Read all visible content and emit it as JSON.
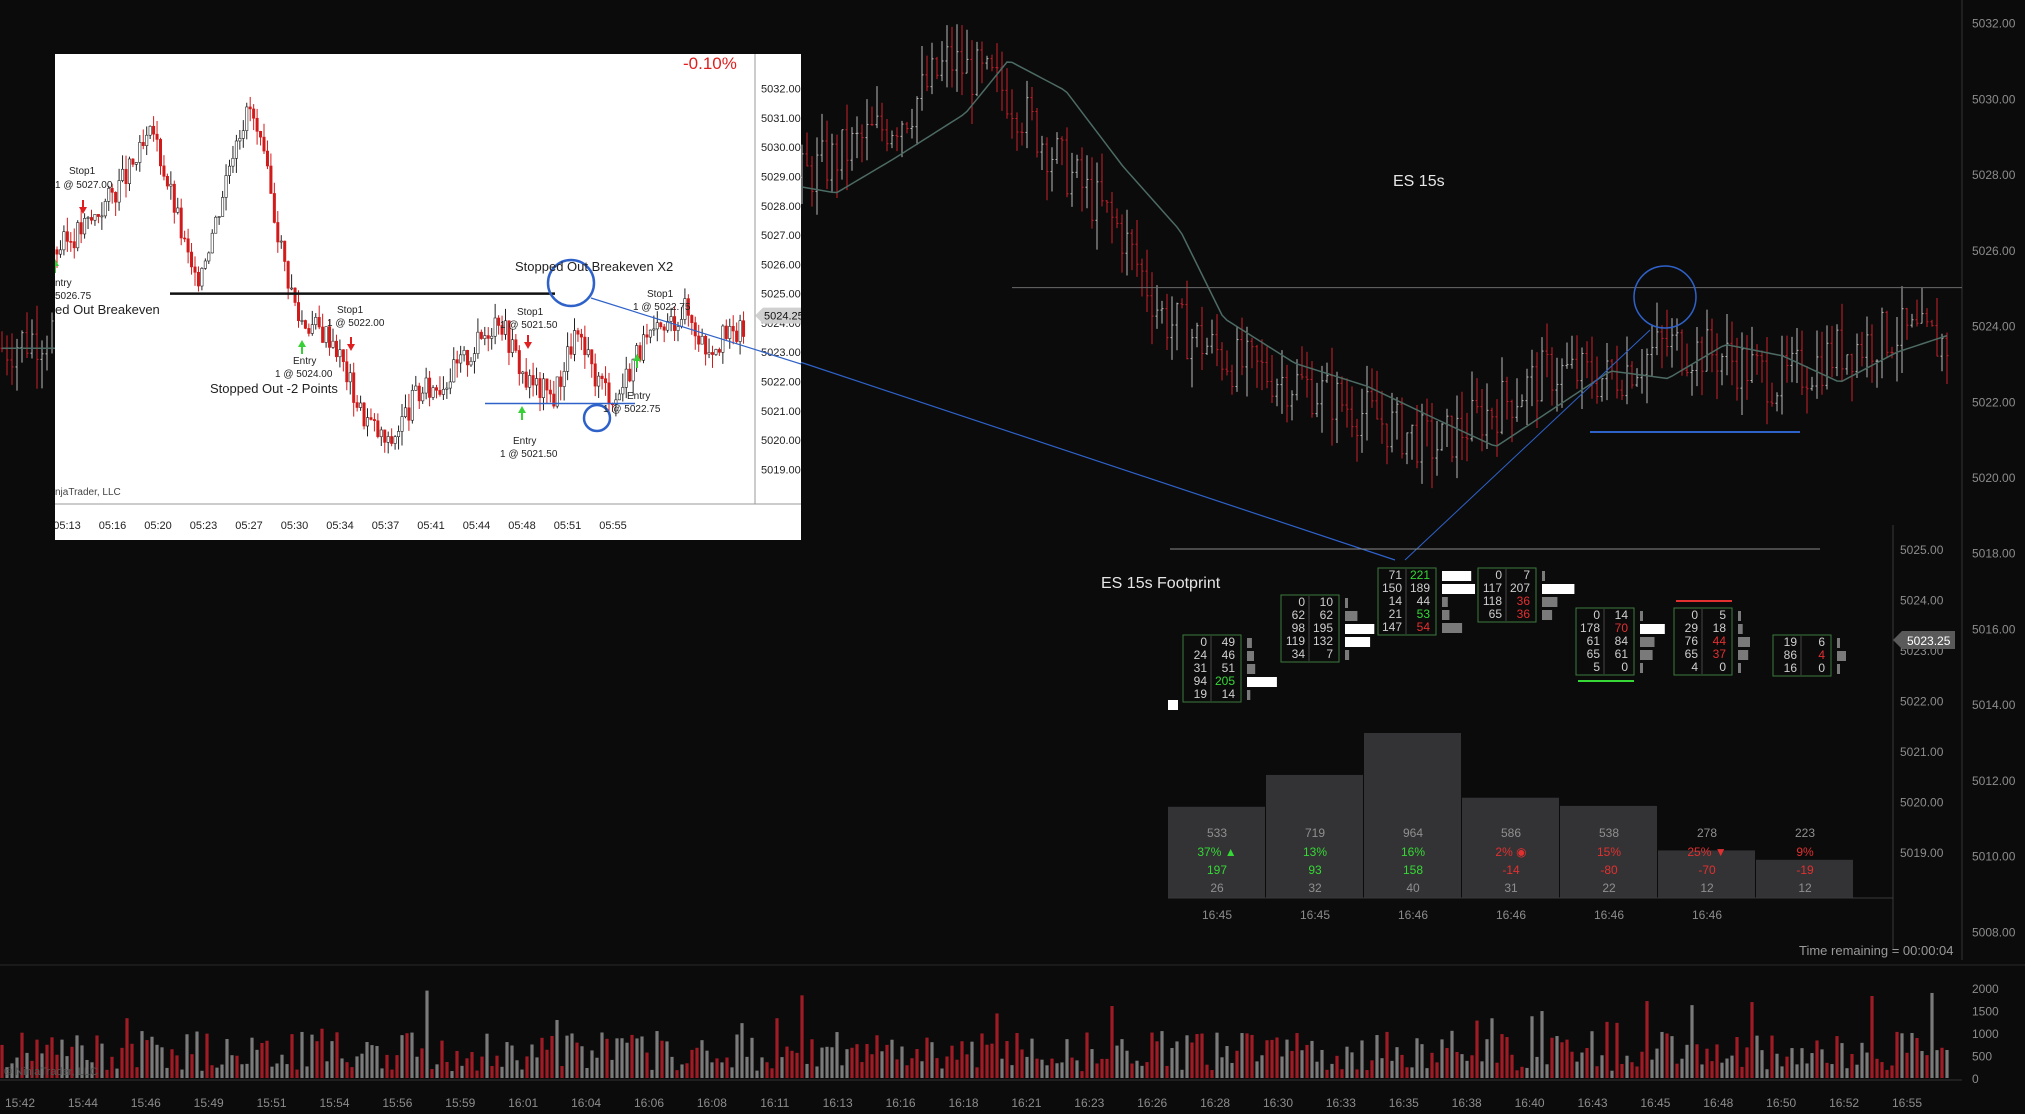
{
  "colors": {
    "background": "#0b0b0c",
    "up_candle": "#b9b9b9",
    "down_candle": "#c8202a",
    "ma_line": "#4d6b63",
    "grid": "#2a2a2a",
    "axis_text": "#8c8c8c",
    "annotation_blue": "#2f62c9",
    "inset_bg": "#ffffff",
    "inset_text": "#222222",
    "inset_down": "#d11a1a",
    "buy_green": "#35d835",
    "sell_red": "#e23030"
  },
  "main": {
    "chart_label": "ES 15s",
    "footprint_label": "ES 15s Footprint",
    "time_remaining": "Time remaining = 00:00:04",
    "price_axis": [
      "5032.00",
      "5030.00",
      "5028.00",
      "5026.00",
      "5024.00",
      "5022.00",
      "5020.00",
      "5018.00",
      "5016.00",
      "5014.00",
      "5012.00",
      "5010.00",
      "5008.00"
    ],
    "footprint_axis": [
      "5025.00",
      "5024.00",
      "5023.00",
      "5022.00",
      "5021.00",
      "5020.00",
      "5019.00"
    ],
    "current_price": "5023.25",
    "volume_axis": [
      "2000",
      "1500",
      "1000",
      "500",
      "0"
    ],
    "watermark": "© NinjaTrader, LLC",
    "time_axis": [
      "15:42",
      "15:44",
      "15:46",
      "15:49",
      "15:51",
      "15:54",
      "15:56",
      "15:59",
      "16:01",
      "16:04",
      "16:06",
      "16:08",
      "16:11",
      "16:13",
      "16:16",
      "16:18",
      "16:21",
      "16:23",
      "16:26",
      "16:28",
      "16:30",
      "16:33",
      "16:35",
      "16:38",
      "16:40",
      "16:43",
      "16:45",
      "16:48",
      "16:50",
      "16:52",
      "16:55"
    ]
  },
  "inset": {
    "percent_change": "-0.10%",
    "price_axis": [
      "5032.00",
      "5031.00",
      "5030.00",
      "5029.00",
      "5028.00",
      "5027.00",
      "5026.00",
      "5025.00",
      "5024.00",
      "5023.00",
      "5022.00",
      "5021.00",
      "5020.00",
      "5019.00"
    ],
    "current_price": "5024.25",
    "time_axis": [
      "05:13",
      "05:16",
      "05:20",
      "05:23",
      "05:27",
      "05:30",
      "05:34",
      "05:37",
      "05:41",
      "05:44",
      "05:48",
      "05:51",
      "05:55"
    ],
    "watermark": "njaTrader, LLC",
    "annotations": {
      "stop_left": "Stop1",
      "stop_left_price": "1 @ 5027.00",
      "entry_left": "ntry",
      "entry_left_price": "5026.75",
      "stopped_breakeven": "ed Out Breakeven",
      "entry_mid": "Entry",
      "entry_mid_price": "1 @ 5024.00",
      "stop_mid": "Stop1",
      "stop_mid_price": "1 @ 5022.00",
      "stopped_minus2": "Stopped Out -2 Points",
      "stopped_breakeven_x2": "Stopped Out Breakeven X2",
      "stop_right1": "Stop1",
      "stop_right1_price": "1 @ 5021.50",
      "entry_right1": "Entry",
      "entry_right1_price": "1 @ 5021.50",
      "stop_right2": "Stop1",
      "stop_right2_price": "1 @ 5022.75",
      "entry_right2": "Entry",
      "entry_right2_price": "1 @ 5022.75"
    }
  },
  "footprint": {
    "time_axis": [
      "16:45",
      "16:45",
      "16:46",
      "16:46",
      "16:46",
      "16:46"
    ],
    "columns": [
      {
        "rows": [
          [
            "0",
            "49"
          ],
          [
            "24",
            "46"
          ],
          [
            "31",
            "51"
          ],
          [
            "94",
            "205"
          ],
          [
            "19",
            "14"
          ]
        ]
      },
      {
        "rows": [
          [
            "0",
            "10"
          ],
          [
            "62",
            "62"
          ],
          [
            "98",
            "195"
          ],
          [
            "119",
            "132"
          ],
          [
            "34",
            "7"
          ]
        ]
      },
      {
        "rows": [
          [
            "71",
            "221"
          ],
          [
            "150",
            "189"
          ],
          [
            "14",
            "44"
          ],
          [
            "21",
            "53"
          ],
          [
            "147",
            "54"
          ]
        ]
      },
      {
        "rows": [
          [
            "0",
            "7"
          ],
          [
            "117",
            "207"
          ],
          [
            "118",
            "36"
          ],
          [
            "65",
            "36"
          ]
        ]
      },
      {
        "rows": [
          [
            "0",
            "14"
          ],
          [
            "178",
            "70"
          ],
          [
            "61",
            "84"
          ],
          [
            "65",
            "61"
          ],
          [
            "5",
            "0"
          ]
        ]
      },
      {
        "rows": [
          [
            "0",
            "5"
          ],
          [
            "29",
            "18"
          ],
          [
            "76",
            "44"
          ],
          [
            "65",
            "37"
          ],
          [
            "4",
            "0"
          ]
        ]
      },
      {
        "rows": [
          [
            "19",
            "6"
          ],
          [
            "86",
            "4"
          ],
          [
            "16",
            "0"
          ]
        ]
      }
    ],
    "summary": {
      "volume": [
        "533",
        "719",
        "964",
        "586",
        "538",
        "278",
        "223"
      ],
      "delta_pct": [
        "37% ▲",
        "13%",
        "16%",
        "2% ◉",
        "15%",
        "25% ▼",
        "9%"
      ],
      "delta": [
        "197",
        "93",
        "158",
        "-14",
        "-80",
        "-70",
        "-19"
      ],
      "trades": [
        "26",
        "32",
        "40",
        "31",
        "22",
        "12",
        "12"
      ]
    }
  },
  "chart_data": [
    {
      "type": "candlestick",
      "title": "ES 15s",
      "xlabel": "",
      "ylabel": "",
      "ylim": [
        5007,
        5033
      ],
      "x_ticks": [
        "15:42",
        "15:44",
        "15:46",
        "15:49",
        "15:51",
        "15:54",
        "15:56",
        "15:59",
        "16:01",
        "16:04",
        "16:06",
        "16:08",
        "16:11",
        "16:13",
        "16:16",
        "16:18",
        "16:21",
        "16:23",
        "16:26",
        "16:28",
        "16:30",
        "16:33",
        "16:35",
        "16:38",
        "16:40",
        "16:43",
        "16:45",
        "16:48",
        "16:50",
        "16:52",
        "16:55"
      ],
      "close_path": [
        [
          15.64,
          5023.4
        ],
        [
          15.72,
          5024.5
        ],
        [
          15.8,
          5025.6
        ],
        [
          15.87,
          5024.2
        ],
        [
          15.93,
          5025.0
        ],
        [
          16.0,
          5024.8
        ],
        [
          16.05,
          5025.6
        ],
        [
          16.08,
          5027.0
        ],
        [
          16.12,
          5027.9
        ],
        [
          16.18,
          5027.5
        ],
        [
          16.22,
          5028.4
        ],
        [
          16.27,
          5029.6
        ],
        [
          16.3,
          5031.0
        ],
        [
          16.34,
          5030.2
        ],
        [
          16.38,
          5028.2
        ],
        [
          16.42,
          5026.5
        ],
        [
          16.45,
          5024.2
        ],
        [
          16.5,
          5023.0
        ],
        [
          16.55,
          5022.4
        ],
        [
          16.6,
          5021.5
        ],
        [
          16.64,
          5020.8
        ],
        [
          16.68,
          5021.8
        ],
        [
          16.72,
          5022.8
        ],
        [
          16.76,
          5022.6
        ],
        [
          16.8,
          5023.5
        ],
        [
          16.84,
          5023.2
        ],
        [
          16.88,
          5022.5
        ],
        [
          16.92,
          5023.3
        ],
        [
          16.96,
          5023.8
        ],
        [
          17.0,
          5023.5
        ]
      ],
      "horizontal_level": 5025.0,
      "volume_ylim": [
        0,
        2400
      ]
    },
    {
      "type": "candlestick",
      "title": "",
      "percent_change": "-0.10%",
      "ylim": [
        5018.5,
        5032.5
      ],
      "x_ticks": [
        "05:13",
        "05:16",
        "05:20",
        "05:23",
        "05:27",
        "05:30",
        "05:34",
        "05:37",
        "05:41",
        "05:44",
        "05:48",
        "05:51",
        "05:55"
      ],
      "horizontal_level": 5025.0
    }
  ]
}
